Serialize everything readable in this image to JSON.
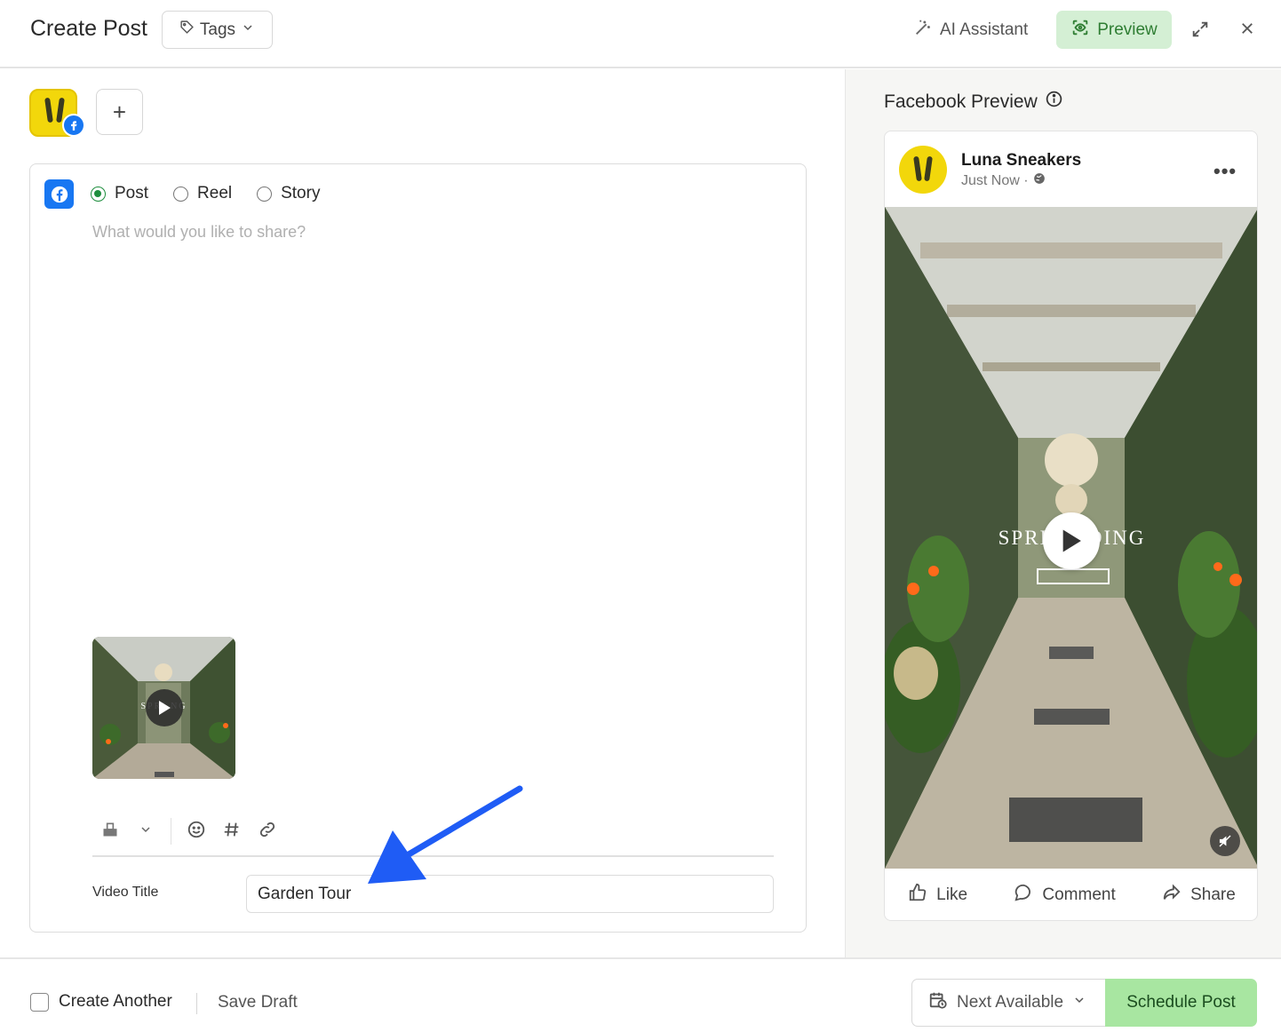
{
  "header": {
    "title": "Create Post",
    "tags_label": "Tags",
    "ai_label": "AI Assistant",
    "preview_label": "Preview"
  },
  "editor": {
    "post_types": [
      {
        "label": "Post",
        "selected": true
      },
      {
        "label": "Reel",
        "selected": false
      },
      {
        "label": "Story",
        "selected": false
      }
    ],
    "placeholder": "What would you like to share?",
    "video_title_label": "Video Title",
    "video_title_value": "Garden Tour",
    "thumb_overlay_text": "SPRI NG"
  },
  "preview": {
    "title": "Facebook Preview",
    "page_name": "Luna Sneakers",
    "time": "Just Now ·",
    "overlay_text": "SPRIN ADING",
    "actions": {
      "like": "Like",
      "comment": "Comment",
      "share": "Share"
    }
  },
  "footer": {
    "create_another": "Create Another",
    "save_draft": "Save Draft",
    "next_available": "Next Available",
    "schedule": "Schedule Post"
  },
  "colors": {
    "accent_green": "#2e7d32",
    "preview_bg": "#d4efd4",
    "schedule_bg": "#a8e6a1",
    "facebook_blue": "#1877f2",
    "annotation_arrow": "#1f5cf5"
  }
}
